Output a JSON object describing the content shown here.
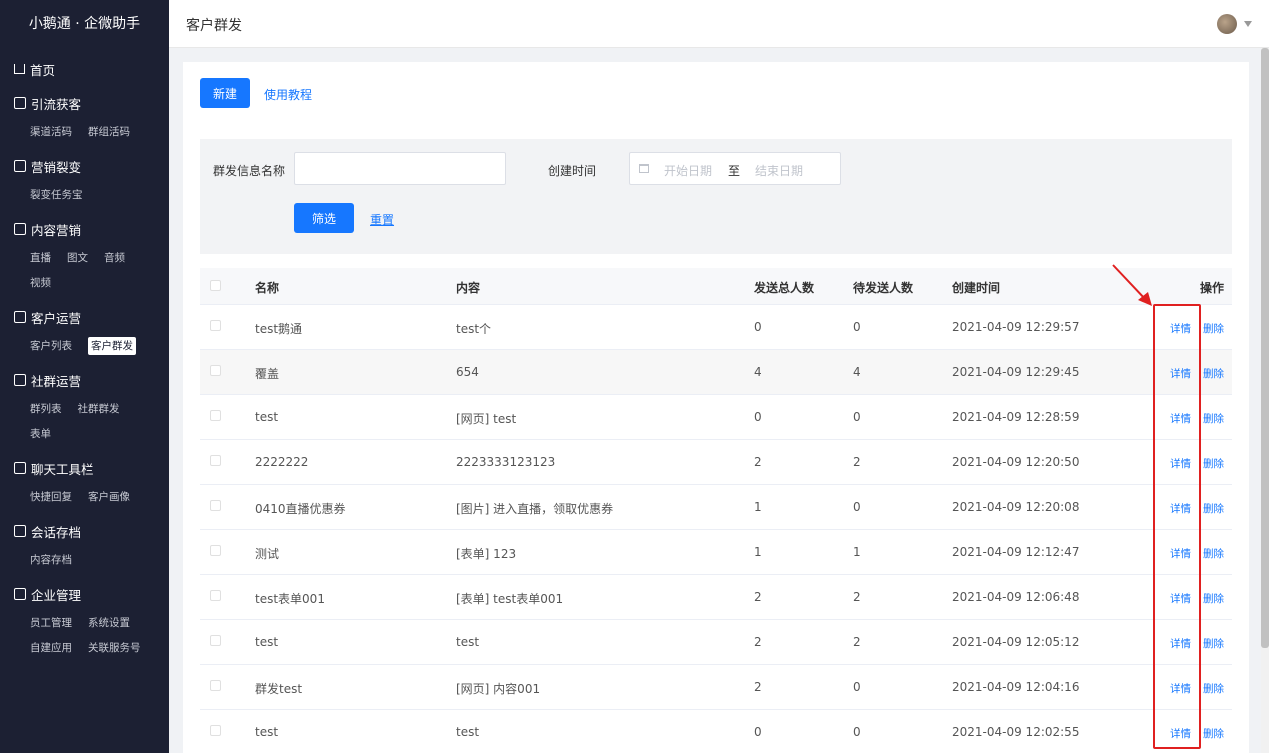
{
  "brand": "小鹅通 · 企微助手",
  "sidebar": {
    "groups": [
      {
        "title": "首页",
        "items": []
      },
      {
        "title": "引流获客",
        "items": [
          "渠道活码",
          "群组活码"
        ]
      },
      {
        "title": "营销裂变",
        "items": [
          "裂变任务宝"
        ]
      },
      {
        "title": "内容营销",
        "items": [
          "直播",
          "图文",
          "音频",
          "视频"
        ]
      },
      {
        "title": "客户运营",
        "items": [
          "客户列表",
          "客户群发"
        ]
      },
      {
        "title": "社群运营",
        "items": [
          "群列表",
          "社群群发",
          "表单"
        ]
      },
      {
        "title": "聊天工具栏",
        "items": [
          "快捷回复",
          "客户画像"
        ]
      },
      {
        "title": "会话存档",
        "items": [
          "内容存档"
        ]
      },
      {
        "title": "企业管理",
        "items": [
          "员工管理",
          "系统设置",
          "自建应用",
          "关联服务号"
        ]
      }
    ],
    "active_item": "客户群发"
  },
  "header": {
    "title": "客户群发"
  },
  "toolbar": {
    "new_label": "新建",
    "tutorial_label": "使用教程"
  },
  "filter": {
    "name_label": "群发信息名称",
    "time_label": "创建时间",
    "start_placeholder": "开始日期",
    "range_sep": "至",
    "end_placeholder": "结束日期",
    "filter_label": "筛选",
    "reset_label": "重置"
  },
  "table": {
    "headers": {
      "name": "名称",
      "content": "内容",
      "total": "发送总人数",
      "pending": "待发送人数",
      "time": "创建时间",
      "ops": "操作"
    },
    "detail_label": "详情",
    "delete_label": "删除",
    "rows": [
      {
        "name": "test鹅通",
        "content": "test个",
        "total": "0",
        "pending": "0",
        "time": "2021-04-09 12:29:57"
      },
      {
        "name": "覆盖",
        "content": "654",
        "total": "4",
        "pending": "4",
        "time": "2021-04-09 12:29:45"
      },
      {
        "name": "test",
        "content": "[网页] test",
        "total": "0",
        "pending": "0",
        "time": "2021-04-09 12:28:59"
      },
      {
        "name": "2222222",
        "content": "2223333123123",
        "total": "2",
        "pending": "2",
        "time": "2021-04-09 12:20:50"
      },
      {
        "name": "0410直播优惠券",
        "content": "[图片] 进入直播，领取优惠券",
        "total": "1",
        "pending": "0",
        "time": "2021-04-09 12:20:08"
      },
      {
        "name": "测试",
        "content": "[表单] 123",
        "total": "1",
        "pending": "1",
        "time": "2021-04-09 12:12:47"
      },
      {
        "name": "test表单001",
        "content": "[表单] test表单001",
        "total": "2",
        "pending": "2",
        "time": "2021-04-09 12:06:48"
      },
      {
        "name": "test",
        "content": "test",
        "total": "2",
        "pending": "2",
        "time": "2021-04-09 12:05:12"
      },
      {
        "name": "群发test",
        "content": "[网页] 内容001",
        "total": "2",
        "pending": "0",
        "time": "2021-04-09 12:04:16"
      },
      {
        "name": "test",
        "content": "test",
        "total": "0",
        "pending": "0",
        "time": "2021-04-09 12:02:55"
      }
    ]
  },
  "colors": {
    "sidebar_bg": "#1c2033",
    "primary": "#1677ff",
    "annotation": "#e02020"
  }
}
